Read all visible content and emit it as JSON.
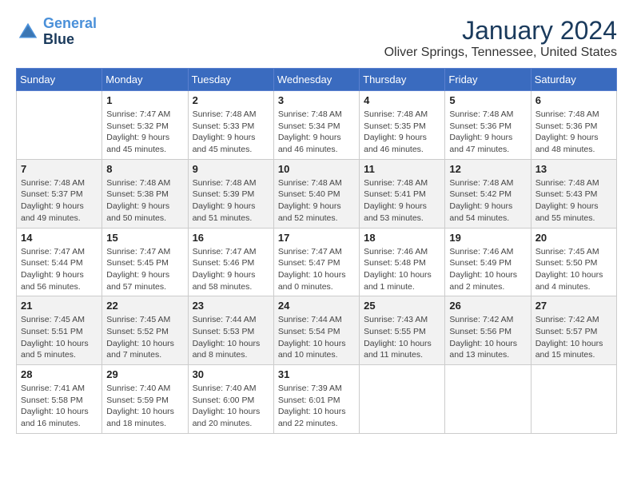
{
  "header": {
    "logo_line1": "General",
    "logo_line2": "Blue",
    "month": "January 2024",
    "location": "Oliver Springs, Tennessee, United States"
  },
  "weekdays": [
    "Sunday",
    "Monday",
    "Tuesday",
    "Wednesday",
    "Thursday",
    "Friday",
    "Saturday"
  ],
  "weeks": [
    [
      {
        "day": "",
        "sunrise": "",
        "sunset": "",
        "daylight": ""
      },
      {
        "day": "1",
        "sunrise": "Sunrise: 7:47 AM",
        "sunset": "Sunset: 5:32 PM",
        "daylight": "Daylight: 9 hours and 45 minutes."
      },
      {
        "day": "2",
        "sunrise": "Sunrise: 7:48 AM",
        "sunset": "Sunset: 5:33 PM",
        "daylight": "Daylight: 9 hours and 45 minutes."
      },
      {
        "day": "3",
        "sunrise": "Sunrise: 7:48 AM",
        "sunset": "Sunset: 5:34 PM",
        "daylight": "Daylight: 9 hours and 46 minutes."
      },
      {
        "day": "4",
        "sunrise": "Sunrise: 7:48 AM",
        "sunset": "Sunset: 5:35 PM",
        "daylight": "Daylight: 9 hours and 46 minutes."
      },
      {
        "day": "5",
        "sunrise": "Sunrise: 7:48 AM",
        "sunset": "Sunset: 5:36 PM",
        "daylight": "Daylight: 9 hours and 47 minutes."
      },
      {
        "day": "6",
        "sunrise": "Sunrise: 7:48 AM",
        "sunset": "Sunset: 5:36 PM",
        "daylight": "Daylight: 9 hours and 48 minutes."
      }
    ],
    [
      {
        "day": "7",
        "sunrise": "Sunrise: 7:48 AM",
        "sunset": "Sunset: 5:37 PM",
        "daylight": "Daylight: 9 hours and 49 minutes."
      },
      {
        "day": "8",
        "sunrise": "Sunrise: 7:48 AM",
        "sunset": "Sunset: 5:38 PM",
        "daylight": "Daylight: 9 hours and 50 minutes."
      },
      {
        "day": "9",
        "sunrise": "Sunrise: 7:48 AM",
        "sunset": "Sunset: 5:39 PM",
        "daylight": "Daylight: 9 hours and 51 minutes."
      },
      {
        "day": "10",
        "sunrise": "Sunrise: 7:48 AM",
        "sunset": "Sunset: 5:40 PM",
        "daylight": "Daylight: 9 hours and 52 minutes."
      },
      {
        "day": "11",
        "sunrise": "Sunrise: 7:48 AM",
        "sunset": "Sunset: 5:41 PM",
        "daylight": "Daylight: 9 hours and 53 minutes."
      },
      {
        "day": "12",
        "sunrise": "Sunrise: 7:48 AM",
        "sunset": "Sunset: 5:42 PM",
        "daylight": "Daylight: 9 hours and 54 minutes."
      },
      {
        "day": "13",
        "sunrise": "Sunrise: 7:48 AM",
        "sunset": "Sunset: 5:43 PM",
        "daylight": "Daylight: 9 hours and 55 minutes."
      }
    ],
    [
      {
        "day": "14",
        "sunrise": "Sunrise: 7:47 AM",
        "sunset": "Sunset: 5:44 PM",
        "daylight": "Daylight: 9 hours and 56 minutes."
      },
      {
        "day": "15",
        "sunrise": "Sunrise: 7:47 AM",
        "sunset": "Sunset: 5:45 PM",
        "daylight": "Daylight: 9 hours and 57 minutes."
      },
      {
        "day": "16",
        "sunrise": "Sunrise: 7:47 AM",
        "sunset": "Sunset: 5:46 PM",
        "daylight": "Daylight: 9 hours and 58 minutes."
      },
      {
        "day": "17",
        "sunrise": "Sunrise: 7:47 AM",
        "sunset": "Sunset: 5:47 PM",
        "daylight": "Daylight: 10 hours and 0 minutes."
      },
      {
        "day": "18",
        "sunrise": "Sunrise: 7:46 AM",
        "sunset": "Sunset: 5:48 PM",
        "daylight": "Daylight: 10 hours and 1 minute."
      },
      {
        "day": "19",
        "sunrise": "Sunrise: 7:46 AM",
        "sunset": "Sunset: 5:49 PM",
        "daylight": "Daylight: 10 hours and 2 minutes."
      },
      {
        "day": "20",
        "sunrise": "Sunrise: 7:45 AM",
        "sunset": "Sunset: 5:50 PM",
        "daylight": "Daylight: 10 hours and 4 minutes."
      }
    ],
    [
      {
        "day": "21",
        "sunrise": "Sunrise: 7:45 AM",
        "sunset": "Sunset: 5:51 PM",
        "daylight": "Daylight: 10 hours and 5 minutes."
      },
      {
        "day": "22",
        "sunrise": "Sunrise: 7:45 AM",
        "sunset": "Sunset: 5:52 PM",
        "daylight": "Daylight: 10 hours and 7 minutes."
      },
      {
        "day": "23",
        "sunrise": "Sunrise: 7:44 AM",
        "sunset": "Sunset: 5:53 PM",
        "daylight": "Daylight: 10 hours and 8 minutes."
      },
      {
        "day": "24",
        "sunrise": "Sunrise: 7:44 AM",
        "sunset": "Sunset: 5:54 PM",
        "daylight": "Daylight: 10 hours and 10 minutes."
      },
      {
        "day": "25",
        "sunrise": "Sunrise: 7:43 AM",
        "sunset": "Sunset: 5:55 PM",
        "daylight": "Daylight: 10 hours and 11 minutes."
      },
      {
        "day": "26",
        "sunrise": "Sunrise: 7:42 AM",
        "sunset": "Sunset: 5:56 PM",
        "daylight": "Daylight: 10 hours and 13 minutes."
      },
      {
        "day": "27",
        "sunrise": "Sunrise: 7:42 AM",
        "sunset": "Sunset: 5:57 PM",
        "daylight": "Daylight: 10 hours and 15 minutes."
      }
    ],
    [
      {
        "day": "28",
        "sunrise": "Sunrise: 7:41 AM",
        "sunset": "Sunset: 5:58 PM",
        "daylight": "Daylight: 10 hours and 16 minutes."
      },
      {
        "day": "29",
        "sunrise": "Sunrise: 7:40 AM",
        "sunset": "Sunset: 5:59 PM",
        "daylight": "Daylight: 10 hours and 18 minutes."
      },
      {
        "day": "30",
        "sunrise": "Sunrise: 7:40 AM",
        "sunset": "Sunset: 6:00 PM",
        "daylight": "Daylight: 10 hours and 20 minutes."
      },
      {
        "day": "31",
        "sunrise": "Sunrise: 7:39 AM",
        "sunset": "Sunset: 6:01 PM",
        "daylight": "Daylight: 10 hours and 22 minutes."
      },
      {
        "day": "",
        "sunrise": "",
        "sunset": "",
        "daylight": ""
      },
      {
        "day": "",
        "sunrise": "",
        "sunset": "",
        "daylight": ""
      },
      {
        "day": "",
        "sunrise": "",
        "sunset": "",
        "daylight": ""
      }
    ]
  ]
}
